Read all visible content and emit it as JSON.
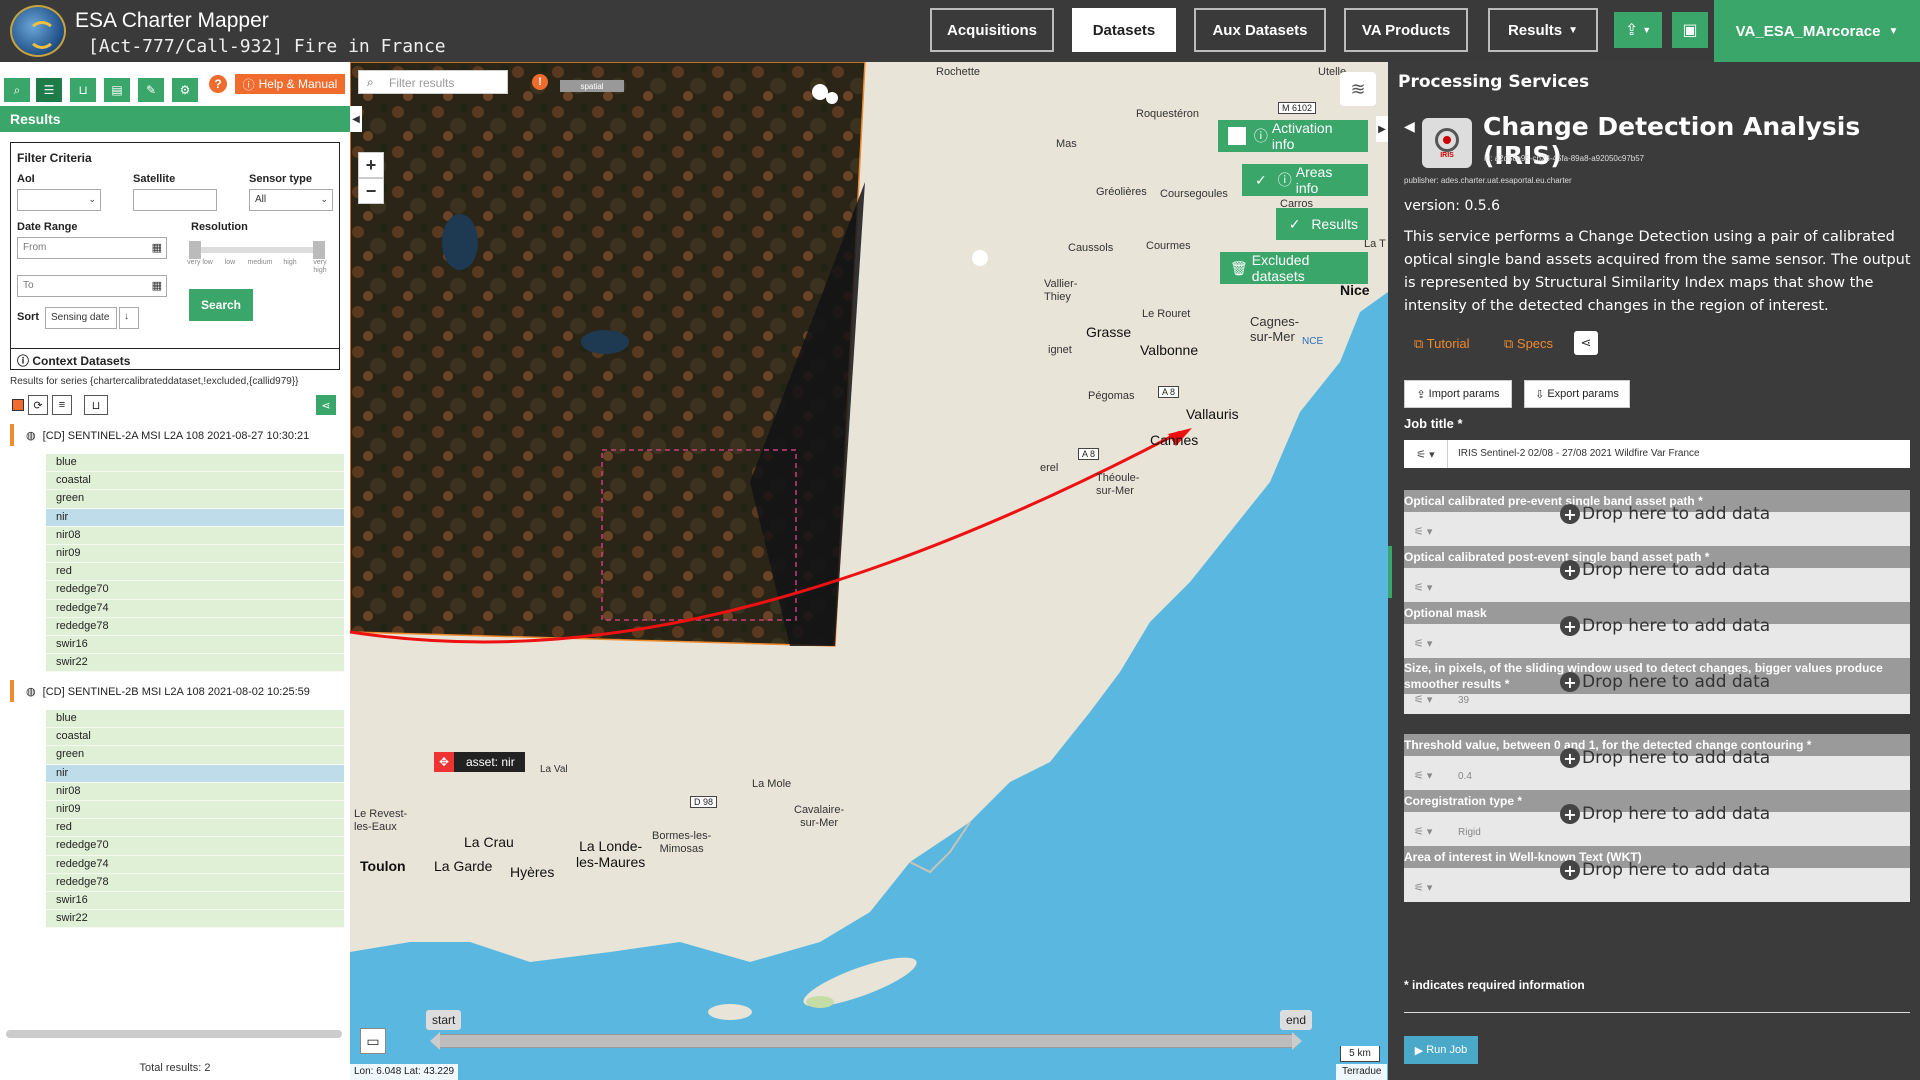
{
  "header": {
    "app_title": "ESA Charter Mapper",
    "subtitle": "[Act-777/Call-932] Fire in France",
    "nav": [
      "Acquisitions",
      "Datasets",
      "Aux Datasets",
      "VA Products",
      "Results"
    ],
    "active_nav": "Datasets",
    "user": "VA_ESA_MArcorace"
  },
  "left": {
    "help_label": "Help & Manual",
    "results_title": "Results",
    "filter": {
      "title": "Filter Criteria",
      "aoi_label": "AoI",
      "satellite_label": "Satellite",
      "sensor_label": "Sensor type",
      "sensor_value": "All",
      "date_label": "Date Range",
      "from_placeholder": "From",
      "to_placeholder": "To",
      "resolution_label": "Resolution",
      "resolution_ticks": [
        "very low",
        "low",
        "medium",
        "high",
        "very high"
      ],
      "sort_label": "Sort",
      "sort_value": "Sensing date",
      "search_label": "Search"
    },
    "context_title": "Context Datasets",
    "series_text": "Results for series {chartercalibrateddataset,!excluded,{callid979}}",
    "datasets": [
      {
        "title": "[CD] SENTINEL-2A MSI L2A 108 2021-08-27 10:30:21",
        "bands": [
          "blue",
          "coastal",
          "green",
          "nir",
          "nir08",
          "nir09",
          "red",
          "rededge70",
          "rededge74",
          "rededge78",
          "swir16",
          "swir22"
        ],
        "selected": "nir"
      },
      {
        "title": "[CD] SENTINEL-2B MSI L2A 108 2021-08-02 10:25:59",
        "bands": [
          "blue",
          "coastal",
          "green",
          "nir",
          "nir08",
          "nir09",
          "red",
          "rededge70",
          "rededge74",
          "rededge78",
          "swir16",
          "swir22"
        ],
        "selected": "nir"
      }
    ],
    "total_results": "Total results: 2"
  },
  "map": {
    "filter_placeholder": "Filter results",
    "spatial_label": "spatial",
    "activation_info": "Activation info",
    "areas_info": "Areas info",
    "results_label": "Results",
    "excluded_label": "Excluded datasets",
    "asset_tag": "asset: nir",
    "timeline_start": "start",
    "timeline_end": "end",
    "scale": "5 km",
    "coords": "Lon: 6.048 Lat: 43.229",
    "attribution": "Terradue",
    "places": {
      "utelle": "Utelle",
      "roquesteron": "Roquestéron",
      "mas": "Mas",
      "greolieres": "Gréolières",
      "coursegoules": "Coursegoules",
      "carros": "Carros",
      "caussols": "Caussols",
      "courmes": "Courmes",
      "la_t": "La T",
      "vallier": "Vallier-\nThiey",
      "nice": "Nice",
      "grasse": "Grasse",
      "le_rouret": "Le Rouret",
      "cagnes": "Cagnes-\nsur-Mer",
      "nce": "NCE",
      "ignet": "ignet",
      "valbonne": "Valbonne",
      "pegomas": "Pégomas",
      "vallauris": "Vallauris",
      "cannes": "Cannes",
      "erel": "erel",
      "theoule": "Théoule-\nsur-Mer",
      "la_mole": "La Mole",
      "cavalaire": "Cavalaire-\nsur-Mer",
      "revest": "Le Revest-\nles-Eaux",
      "la_crau": "La Crau",
      "bormes": "Bormes-les-\nMimosas",
      "londe": "La Londe-\nles-Maures",
      "toulon": "Toulon",
      "la_garde": "La Garde",
      "hyeres": "Hyères",
      "la_val": "La Val"
    },
    "roads": {
      "m6102": "M 6102",
      "a8a": "A 8",
      "a8b": "A 8",
      "d98": "D 98"
    }
  },
  "right": {
    "panel_title": "Processing Services",
    "service_title": "Change Detection Analysis (IRIS)",
    "icon_text": "IRIS",
    "service_id": "id: a2d5ce95-cb28-45fa-89a8-a92050c97b57",
    "publisher": "publisher: ades.charter.uat.esaportal.eu.charter",
    "version": "version: 0.5.6",
    "description": "This service performs a Change Detection using a pair of calibrated optical single band assets acquired from the same sensor. The output is represented by Structural Similarity Index maps that show the intensity of the detected changes in the region of interest.",
    "tutorial": "Tutorial",
    "specs": "Specs",
    "import_params": "Import params",
    "export_params": "Export params",
    "job_title_label": "Job title *",
    "job_title_value": "IRIS Sentinel-2 02/08 - 27/08 2021 Wildfire Var France",
    "drop_text": "Drop here to add data",
    "params": [
      {
        "label": "Optical calibrated pre-event single band asset path *",
        "value": ""
      },
      {
        "label": "Optical calibrated post-event single band asset path *",
        "value": ""
      },
      {
        "label": "Optional mask",
        "value": ""
      },
      {
        "label": "Size, in pixels, of the sliding window used to detect changes, bigger values produce smoother results *",
        "value": "39"
      },
      {
        "label": "Threshold value, between 0 and 1, for the detected change contouring *",
        "value": "0.4"
      },
      {
        "label": "Coregistration type *",
        "value": "Rigid"
      },
      {
        "label": "Area of interest in Well-known Text (WKT)",
        "value": ""
      }
    ],
    "required_note": "* indicates required information",
    "run_job": "Run Job"
  },
  "colors": {
    "accent": "#3aa66a",
    "orange": "#ef6c2e",
    "panel": "#3b3b3b",
    "sea": "#5ab8e0"
  }
}
